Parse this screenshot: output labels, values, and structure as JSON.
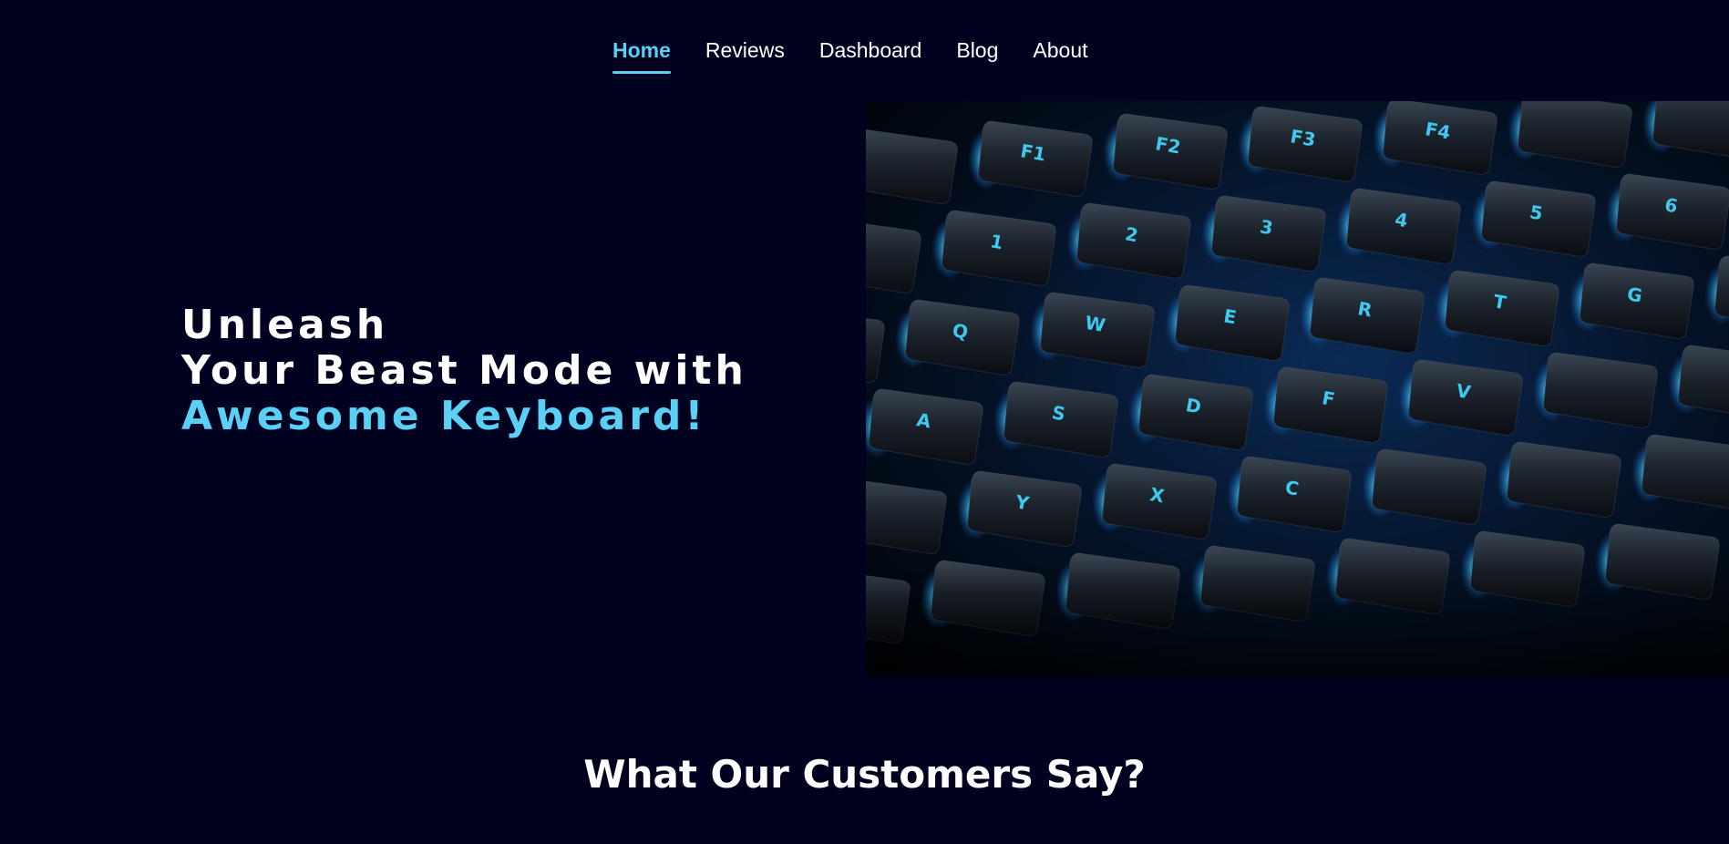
{
  "nav": {
    "items": [
      {
        "label": "Home",
        "active": true
      },
      {
        "label": "Reviews",
        "active": false
      },
      {
        "label": "Dashboard",
        "active": false
      },
      {
        "label": "Blog",
        "active": false
      },
      {
        "label": "About",
        "active": false
      }
    ]
  },
  "hero": {
    "line1": "Unleash",
    "line2": "Your Beast Mode with",
    "line3": "Awesome Keyboard!",
    "image_description_icon": "keyboard-photo"
  },
  "section": {
    "title": "What Our Customers Say?"
  },
  "colors": {
    "background": "#010120",
    "accent": "#5bd0f5",
    "text": "#ffffff"
  }
}
